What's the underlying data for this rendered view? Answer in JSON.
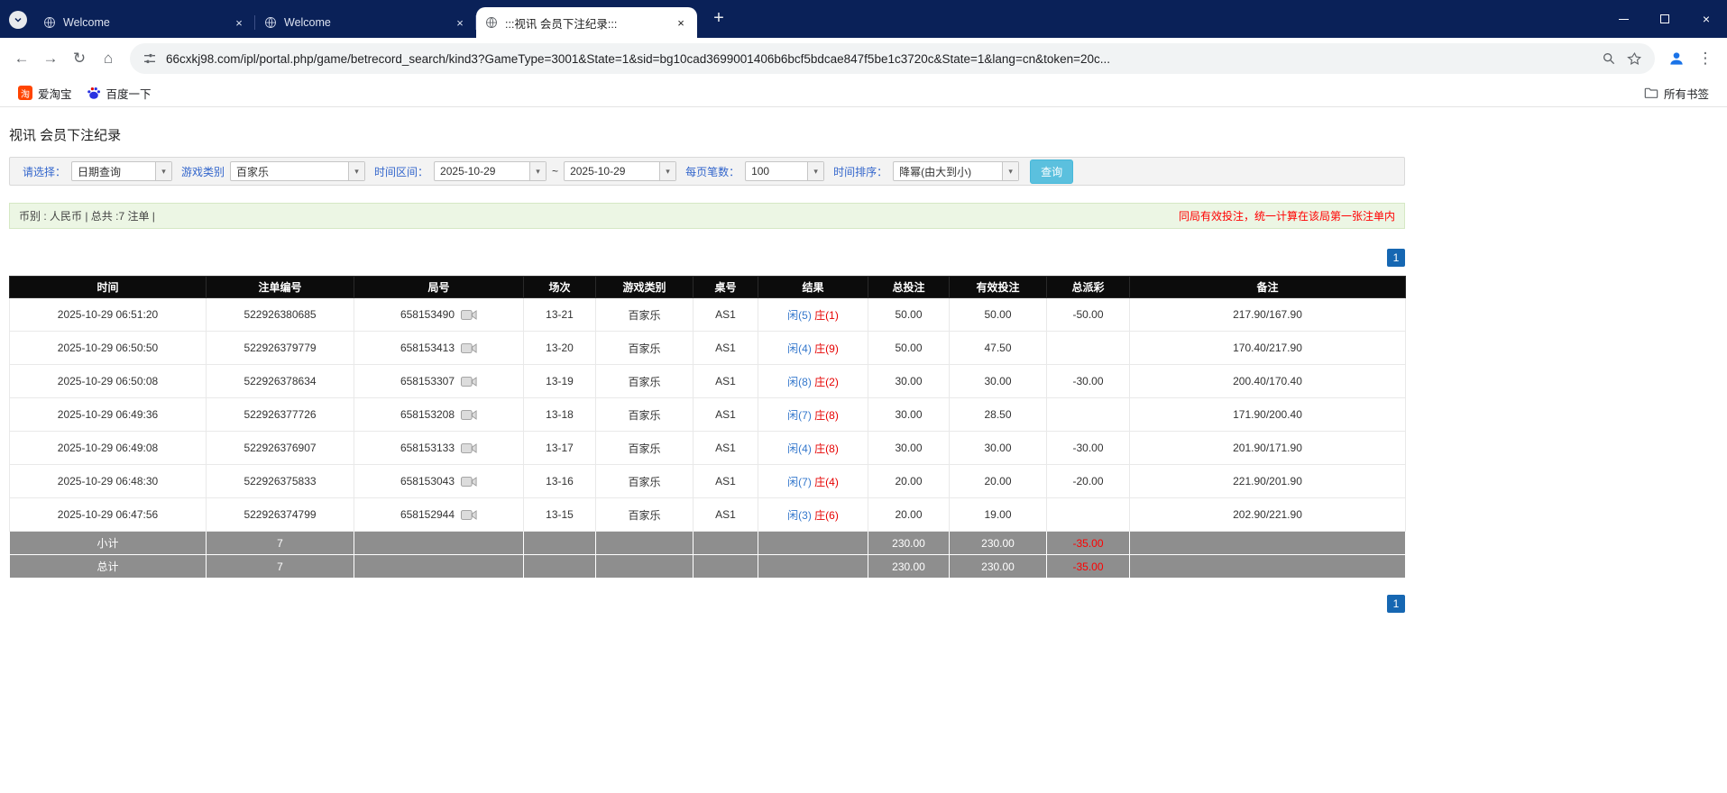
{
  "browser": {
    "tabs": [
      {
        "label": "Welcome"
      },
      {
        "label": "Welcome"
      },
      {
        "label": ":::视讯 会员下注纪录:::"
      }
    ],
    "nav": {
      "url": "66cxkj98.com/ipl/portal.php/game/betrecord_search/kind3?GameType=3001&State=1&sid=bg10cad3699001406b6bcf5bdcae847f5be1c3720c&State=1&lang=cn&token=20c..."
    },
    "bookmarks": {
      "items": [
        {
          "label": "爱淘宝"
        },
        {
          "label": "百度一下"
        }
      ],
      "all_bookmarks": "所有书签"
    }
  },
  "icons": {
    "tab_close": "×",
    "new_tab": "+",
    "window_close": "×",
    "back": "←",
    "forward": "→",
    "reload": "↻",
    "home": "⌂",
    "menu": "⋮",
    "chevron_down": "▾",
    "taobao_glyph": "淘"
  },
  "colors": {
    "player_blue": "#3377cc",
    "banker_red": "#e60000",
    "loss_red": "#ff0000",
    "table_header_bg": "#0c0c0c",
    "footer_row_bg": "#8e8e8e",
    "query_button": "#5bc0de",
    "pagination_blue": "#1667b2",
    "summary_bg": "#ecf6e4"
  },
  "page": {
    "title": "视讯 会员下注纪录",
    "filters": {
      "select_label": "请选择：",
      "select_value": "日期查询",
      "game_type_label": "游戏类别",
      "game_type_value": "百家乐",
      "date_range_label": "时间区间：",
      "date_from": "2025-10-29",
      "tilde": "~",
      "date_to": "2025-10-29",
      "page_size_label": "每页笔数：",
      "page_size_value": "100",
      "sort_label": "时间排序：",
      "sort_value": "降幂(由大到小)",
      "search_button": "查询"
    },
    "summary": {
      "left": "币别 : 人民币 | 总共 :7 注单 |",
      "right": "同局有效投注，统一计算在该局第一张注单内"
    },
    "pagination": "1",
    "table": {
      "headers": [
        "时间",
        "注单编号",
        "局号",
        "场次",
        "游戏类别",
        "桌号",
        "结果",
        "总投注",
        "有效投注",
        "总派彩",
        "备注"
      ],
      "rows": [
        {
          "time": "2025-10-29 06:51:20",
          "bet_id": "522926380685",
          "round": "658153490",
          "session": "13-21",
          "game": "百家乐",
          "table_no": "AS1",
          "result_player": "闲(5)",
          "result_banker": "庄(1)",
          "total_bet": "50.00",
          "valid_bet": "50.00",
          "payout": "-50.00",
          "note": "217.90/167.90"
        },
        {
          "time": "2025-10-29 06:50:50",
          "bet_id": "522926379779",
          "round": "658153413",
          "session": "13-20",
          "game": "百家乐",
          "table_no": "AS1",
          "result_player": "闲(4)",
          "result_banker": "庄(9)",
          "total_bet": "50.00",
          "valid_bet": "47.50",
          "payout": "",
          "note": "170.40/217.90"
        },
        {
          "time": "2025-10-29 06:50:08",
          "bet_id": "522926378634",
          "round": "658153307",
          "session": "13-19",
          "game": "百家乐",
          "table_no": "AS1",
          "result_player": "闲(8)",
          "result_banker": "庄(2)",
          "total_bet": "30.00",
          "valid_bet": "30.00",
          "payout": "-30.00",
          "note": "200.40/170.40"
        },
        {
          "time": "2025-10-29 06:49:36",
          "bet_id": "522926377726",
          "round": "658153208",
          "session": "13-18",
          "game": "百家乐",
          "table_no": "AS1",
          "result_player": "闲(7)",
          "result_banker": "庄(8)",
          "total_bet": "30.00",
          "valid_bet": "28.50",
          "payout": "",
          "note": "171.90/200.40"
        },
        {
          "time": "2025-10-29 06:49:08",
          "bet_id": "522926376907",
          "round": "658153133",
          "session": "13-17",
          "game": "百家乐",
          "table_no": "AS1",
          "result_player": "闲(4)",
          "result_banker": "庄(8)",
          "total_bet": "30.00",
          "valid_bet": "30.00",
          "payout": "-30.00",
          "note": "201.90/171.90"
        },
        {
          "time": "2025-10-29 06:48:30",
          "bet_id": "522926375833",
          "round": "658153043",
          "session": "13-16",
          "game": "百家乐",
          "table_no": "AS1",
          "result_player": "闲(7)",
          "result_banker": "庄(4)",
          "total_bet": "20.00",
          "valid_bet": "20.00",
          "payout": "-20.00",
          "note": "221.90/201.90"
        },
        {
          "time": "2025-10-29 06:47:56",
          "bet_id": "522926374799",
          "round": "658152944",
          "session": "13-15",
          "game": "百家乐",
          "table_no": "AS1",
          "result_player": "闲(3)",
          "result_banker": "庄(6)",
          "total_bet": "20.00",
          "valid_bet": "19.00",
          "payout": "",
          "note": "202.90/221.90"
        }
      ],
      "subtotal": {
        "label": "小计",
        "count": "7",
        "total_bet": "230.00",
        "valid_bet": "230.00",
        "payout": "-35.00"
      },
      "total": {
        "label": "总计",
        "count": "7",
        "total_bet": "230.00",
        "valid_bet": "230.00",
        "payout": "-35.00"
      }
    }
  }
}
